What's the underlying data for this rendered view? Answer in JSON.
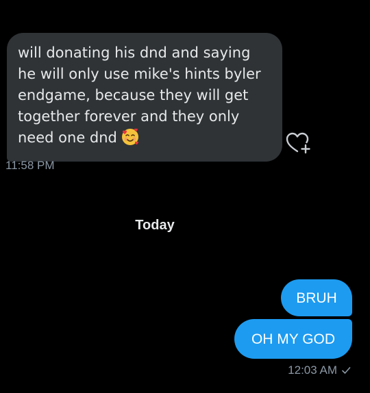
{
  "messages": {
    "incoming": {
      "text_lines": "will donating his dnd and saying\nhe will only use mike's hints byler\nendgame, because they will get\ntogether forever and they only\nneed one dnd",
      "emoji": "smiling-face-with-hearts",
      "timestamp": "11:58 PM"
    },
    "day_divider": "Today",
    "outgoing": [
      {
        "text": "BRUH"
      },
      {
        "text": "OH MY GOD"
      }
    ],
    "outgoing_timestamp": "12:03 AM",
    "outgoing_status_icon": "check-icon"
  },
  "colors": {
    "background": "#000000",
    "incoming_bubble": "#2f3336",
    "outgoing_bubble": "#1d9bf0",
    "timestamp": "#8b98a5",
    "text": "#e7e9ea"
  }
}
